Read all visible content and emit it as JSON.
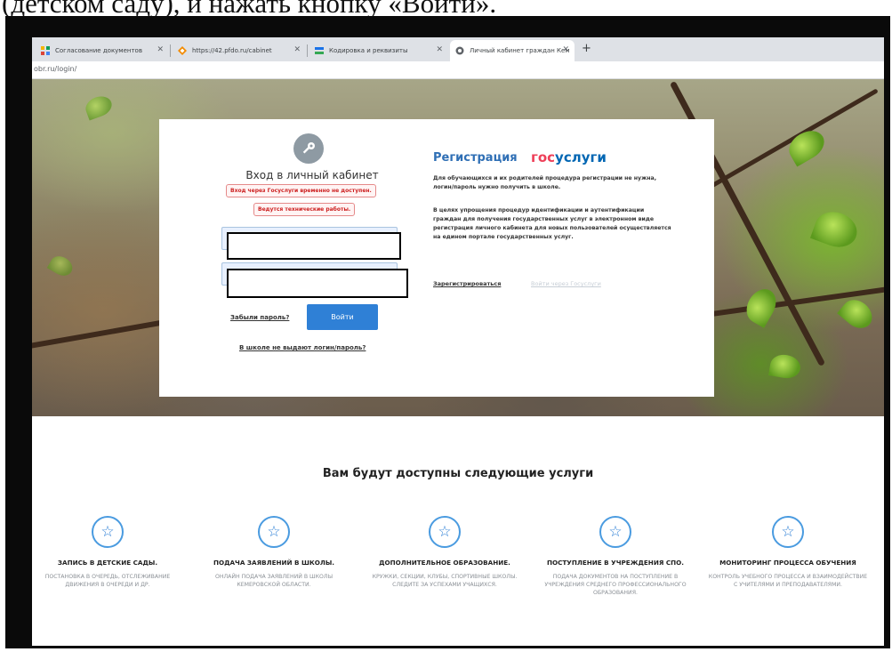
{
  "document": {
    "caption": "(детском саду), и нажать кнопку «Войти»."
  },
  "browser": {
    "tabs": [
      {
        "label": "Согласование документов",
        "icon": "grid-icon"
      },
      {
        "label": "https://42.pfdo.ru/cabinet",
        "icon": "diamond-icon"
      },
      {
        "label": "Кодировка и реквизиты",
        "icon": "stack-icon"
      },
      {
        "label": "Личный кабинет граждан Кем",
        "icon": "page-icon"
      }
    ],
    "new_tab": "+",
    "close_glyph": "✕",
    "address": "obr.ru/login/"
  },
  "login": {
    "title": "Вход в личный кабинет",
    "warning_1": "Вход через Госуслуги временно не доступен.",
    "warning_2": "Ведутся технические работы.",
    "forgot": "Забыли пароль?",
    "submit": "Войти",
    "no_login": "В школе не выдают логин/пароль?"
  },
  "registration": {
    "title": "Регистрация",
    "gos_logo_a": "гос",
    "gos_logo_b": "услуги",
    "text_1": "Для обучающихся и их родителей процедура регистрации не нужна, логин/пароль нужно получить в школе.",
    "text_2": "В целях упрощения процедур идентификации и аутентификации граждан для получения государственных услуг в электронном виде регистрация личного кабинета для новых пользователей осуществляется на едином портале государственных услуг.",
    "register_link": "Зарегистрироваться",
    "gos_link": "Войти через Госуслуги"
  },
  "services": {
    "heading": "Вам будут доступны следующие услуги",
    "icon_glyph": "☆",
    "items": [
      {
        "title": "ЗАПИСЬ В ДЕТСКИЕ САДЫ.",
        "desc": "ПОСТАНОВКА В ОЧЕРЕДЬ, ОТСЛЕЖИВАНИЕ ДВИЖЕНИЯ В ОЧЕРЕДИ И ДР."
      },
      {
        "title": "ПОДАЧА ЗАЯВЛЕНИЙ В ШКОЛЫ.",
        "desc": "ОНЛАЙН ПОДАЧА ЗАЯВЛЕНИЙ В ШКОЛЫ КЕМЕРОВСКОЙ ОБЛАСТИ."
      },
      {
        "title": "ДОПОЛНИТЕЛЬНОЕ ОБРАЗОВАНИЕ.",
        "desc": "КРУЖКИ, СЕКЦИИ, КЛУБЫ, СПОРТИВНЫЕ ШКОЛЫ. СЛЕДИТЕ ЗА УСПЕХАМИ УЧАЩИХСЯ."
      },
      {
        "title": "ПОСТУПЛЕНИЕ В УЧРЕЖДЕНИЯ СПО.",
        "desc": "ПОДАЧА ДОКУМЕНТОВ НА ПОСТУПЛЕНИЕ В УЧРЕЖДЕНИЯ СРЕДНЕГО ПРОФЕССИОНАЛЬНОГО ОБРАЗОВАНИЯ."
      },
      {
        "title": "МОНИТОРИНГ ПРОЦЕССА ОБУЧЕНИЯ",
        "desc": "КОНТРОЛЬ УЧЕБНОГО ПРОЦЕССА И ВЗАИМОДЕЙСТВИЕ С УЧИТЕЛЯМИ И ПРЕПОДАВАТЕЛЯМИ."
      }
    ]
  },
  "colors": {
    "accent": "#2f80d6",
    "warning": "#cc1f1f",
    "gos_red": "#ee3f58",
    "gos_blue": "#0066b3"
  }
}
